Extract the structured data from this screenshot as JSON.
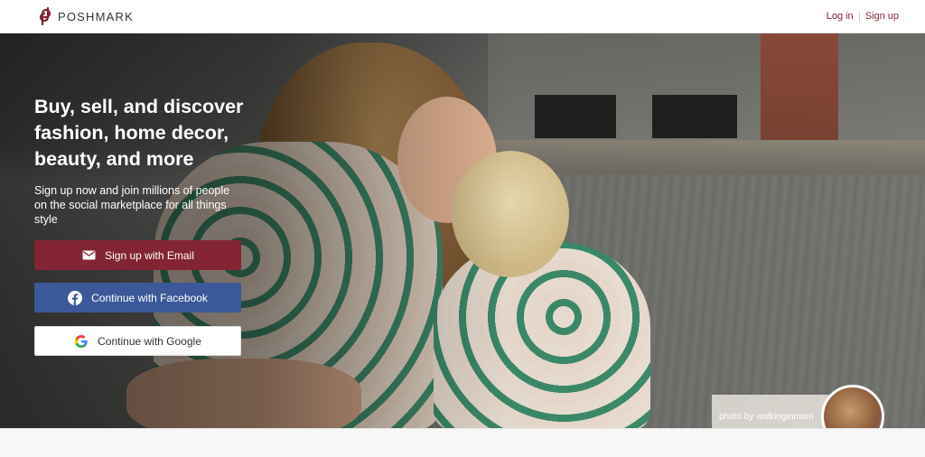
{
  "header": {
    "brand": "POSHMARK",
    "login_label": "Log in",
    "signup_label": "Sign up"
  },
  "hero": {
    "headline": "Buy, sell, and discover fashion, home decor, beauty, and more",
    "subhead": "Sign up now and join millions of people on the social marketplace for all things style",
    "buttons": {
      "email": "Sign up with Email",
      "facebook": "Continue with Facebook",
      "google": "Continue with Google"
    },
    "photo_credit": "photo by walkinginmem"
  },
  "colors": {
    "brand": "#822433",
    "facebook": "#3b5998",
    "white": "#ffffff"
  },
  "icons": {
    "logo": "poshmark-logo-icon",
    "email": "envelope-icon",
    "facebook": "facebook-icon",
    "google": "google-icon"
  }
}
